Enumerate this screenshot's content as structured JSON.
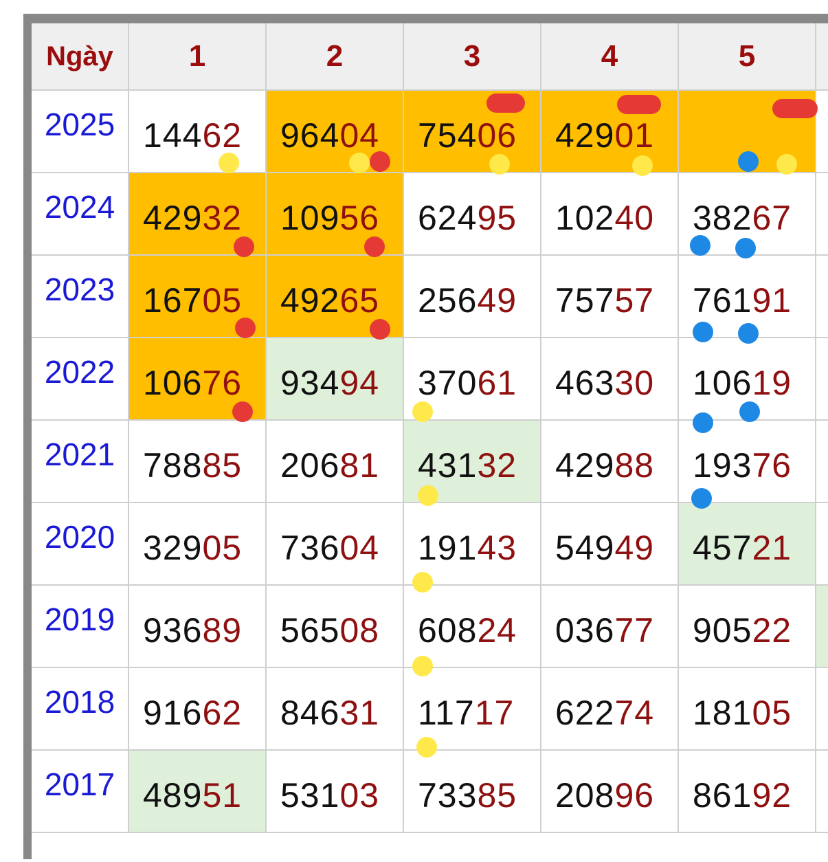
{
  "header": {
    "day_label": "Ngày",
    "columns": [
      "1",
      "2",
      "3",
      "4",
      "5"
    ]
  },
  "rows": [
    {
      "year": "2025",
      "cells": [
        {
          "head": "144",
          "tail": "62",
          "bg": "white"
        },
        {
          "head": "964",
          "tail": "04",
          "bg": "orange"
        },
        {
          "head": "754",
          "tail": "06",
          "bg": "orange"
        },
        {
          "head": "429",
          "tail": "01",
          "bg": "orange"
        },
        {
          "head": "",
          "tail": "",
          "bg": "orange"
        }
      ]
    },
    {
      "year": "2024",
      "cells": [
        {
          "head": "429",
          "tail": "32",
          "bg": "orange"
        },
        {
          "head": "109",
          "tail": "56",
          "bg": "orange"
        },
        {
          "head": "624",
          "tail": "95",
          "bg": "white"
        },
        {
          "head": "102",
          "tail": "40",
          "bg": "white"
        },
        {
          "head": "382",
          "tail": "67",
          "bg": "white"
        }
      ]
    },
    {
      "year": "2023",
      "cells": [
        {
          "head": "167",
          "tail": "05",
          "bg": "orange"
        },
        {
          "head": "492",
          "tail": "65",
          "bg": "orange"
        },
        {
          "head": "256",
          "tail": "49",
          "bg": "white"
        },
        {
          "head": "757",
          "tail": "57",
          "bg": "white"
        },
        {
          "head": "761",
          "tail": "91",
          "bg": "white"
        }
      ]
    },
    {
      "year": "2022",
      "cells": [
        {
          "head": "106",
          "tail": "76",
          "bg": "orange"
        },
        {
          "head": "934",
          "tail": "94",
          "bg": "green"
        },
        {
          "head": "370",
          "tail": "61",
          "bg": "white"
        },
        {
          "head": "463",
          "tail": "30",
          "bg": "white"
        },
        {
          "head": "106",
          "tail": "19",
          "bg": "white"
        }
      ]
    },
    {
      "year": "2021",
      "cells": [
        {
          "head": "788",
          "tail": "85",
          "bg": "white"
        },
        {
          "head": "206",
          "tail": "81",
          "bg": "white"
        },
        {
          "head": "431",
          "tail": "32",
          "bg": "green"
        },
        {
          "head": "429",
          "tail": "88",
          "bg": "white"
        },
        {
          "head": "193",
          "tail": "76",
          "bg": "white"
        }
      ]
    },
    {
      "year": "2020",
      "cells": [
        {
          "head": "329",
          "tail": "05",
          "bg": "white"
        },
        {
          "head": "736",
          "tail": "04",
          "bg": "white"
        },
        {
          "head": "191",
          "tail": "43",
          "bg": "white"
        },
        {
          "head": "549",
          "tail": "49",
          "bg": "white"
        },
        {
          "head": "457",
          "tail": "21",
          "bg": "green"
        }
      ]
    },
    {
      "year": "2019",
      "cells": [
        {
          "head": "936",
          "tail": "89",
          "bg": "white"
        },
        {
          "head": "565",
          "tail": "08",
          "bg": "white"
        },
        {
          "head": "608",
          "tail": "24",
          "bg": "white"
        },
        {
          "head": "036",
          "tail": "77",
          "bg": "white"
        },
        {
          "head": "905",
          "tail": "22",
          "bg": "white"
        }
      ]
    },
    {
      "year": "2018",
      "cells": [
        {
          "head": "916",
          "tail": "62",
          "bg": "white"
        },
        {
          "head": "846",
          "tail": "31",
          "bg": "white"
        },
        {
          "head": "117",
          "tail": "17",
          "bg": "white"
        },
        {
          "head": "622",
          "tail": "74",
          "bg": "white"
        },
        {
          "head": "181",
          "tail": "05",
          "bg": "white"
        }
      ]
    },
    {
      "year": "2017",
      "cells": [
        {
          "head": "489",
          "tail": "51",
          "bg": "green"
        },
        {
          "head": "531",
          "tail": "03",
          "bg": "white"
        },
        {
          "head": "733",
          "tail": "85",
          "bg": "white"
        },
        {
          "head": "208",
          "tail": "96",
          "bg": "white"
        },
        {
          "head": "861",
          "tail": "92",
          "bg": "white"
        }
      ]
    }
  ],
  "colors": {
    "header_text": "#9b0d0d",
    "year_text": "#1a1ad6",
    "tail_digits": "#8f1010",
    "highlight_orange": "#ffbf00",
    "highlight_green": "#dff0da",
    "marker_yellow": "#ffe94a",
    "marker_red": "#e53935",
    "marker_blue": "#1e88e5"
  }
}
